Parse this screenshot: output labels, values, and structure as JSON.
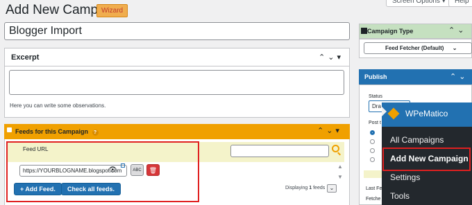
{
  "header": {
    "title": "Add New Campaign",
    "wizard_label": "Wizard",
    "screen_options": "Screen Options ▾",
    "help": "Help"
  },
  "campaign_title": {
    "value": "Blogger Import"
  },
  "excerpt": {
    "heading": "Excerpt",
    "hint": "Here you can write some observations."
  },
  "feeds": {
    "heading": "Feeds for this Campaign",
    "column": "Feed URL",
    "url_value": "https://YOURBLOGNAME.blogspot.com",
    "add_label": "+ Add Feed.",
    "check_label": "Check all feeds.",
    "abc_label": "ABC",
    "displaying": "Displaying",
    "count": "1",
    "feeds_word": "feeds"
  },
  "campaign_type": {
    "heading": "Campaign Type",
    "selected": "Feed Fetcher (Default)"
  },
  "publish": {
    "heading": "Publish",
    "status_label": "Status",
    "status_value": "Dra",
    "post_label": "Post t",
    "last_label": "Last Fe",
    "fetch_label": "Fetche"
  },
  "wpematico_menu": {
    "title": "WPeMatico",
    "items": [
      "All Campaigns",
      "Add New Campaign",
      "Settings",
      "Tools"
    ]
  },
  "colors": {
    "accent": "#2271b1",
    "orange": "#f0a000",
    "highlight_border": "#e02020",
    "menu_bg": "#23282d"
  }
}
